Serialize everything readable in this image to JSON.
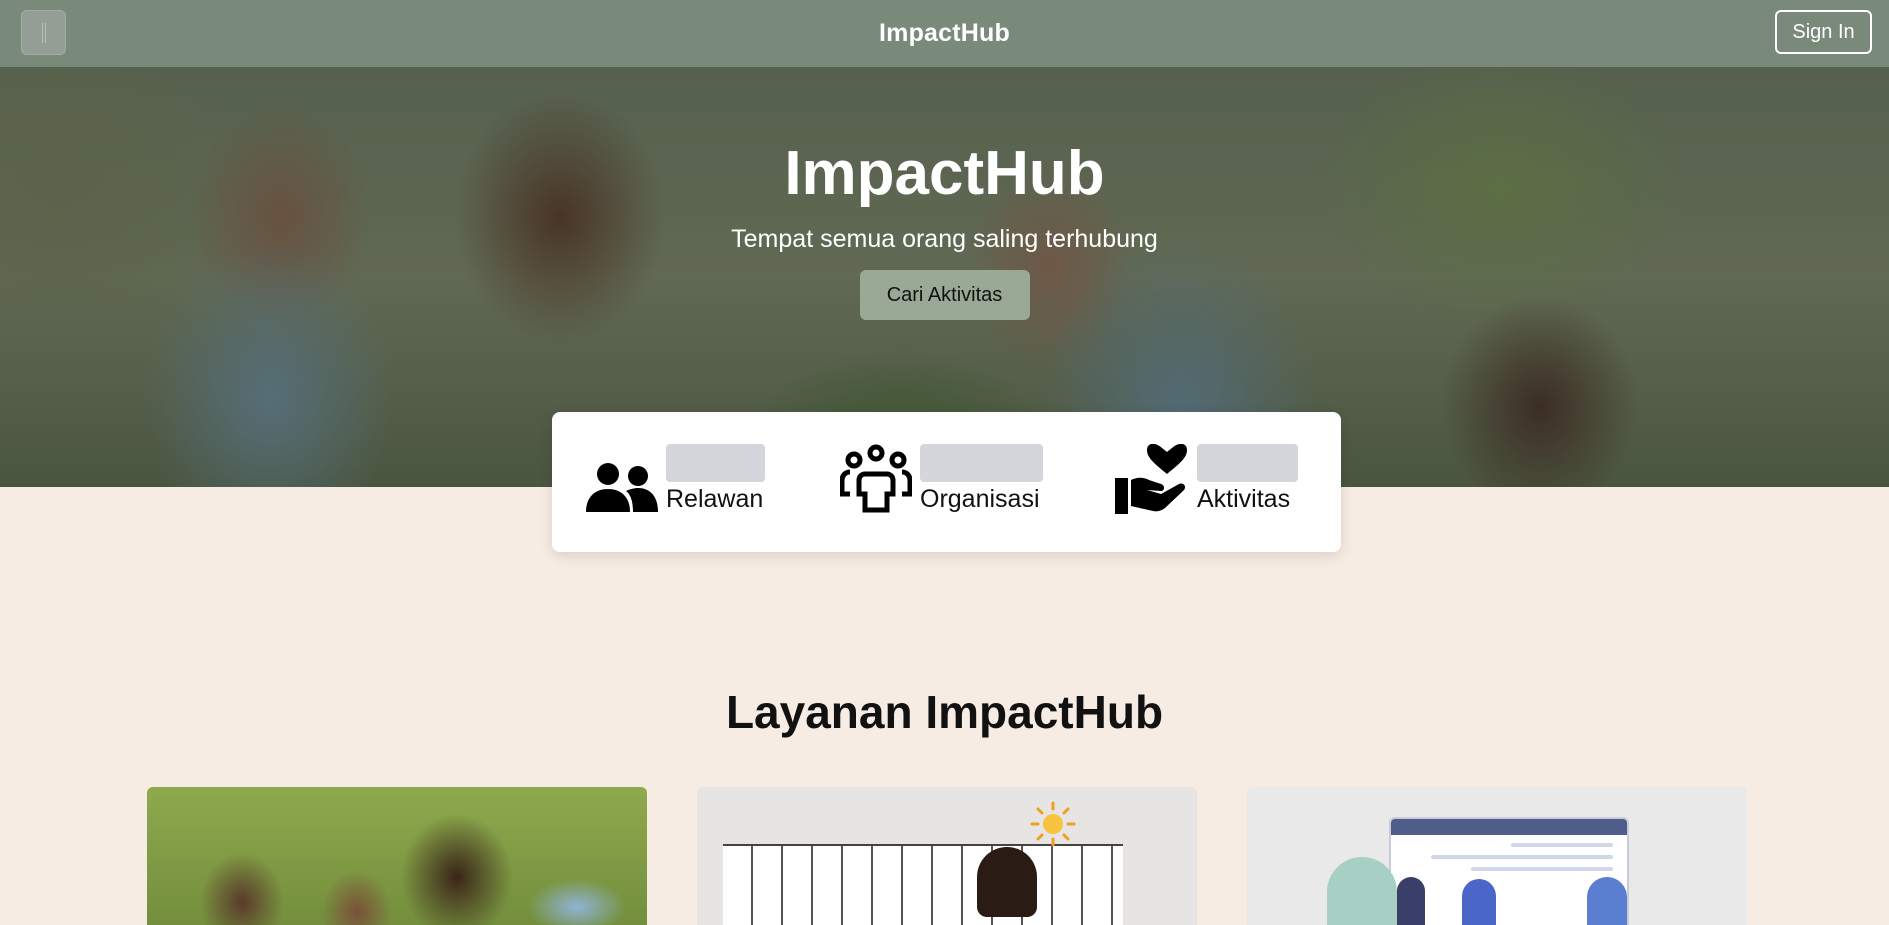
{
  "header": {
    "menu_icon": "menu-icon",
    "brand": "ImpactHub",
    "signin_label": "Sign In"
  },
  "hero": {
    "title": "ImpactHub",
    "subtitle": "Tempat semua orang saling terhubung",
    "cta_label": "Cari Aktivitas"
  },
  "stats": [
    {
      "icon": "people-icon",
      "label": "Relawan"
    },
    {
      "icon": "group-icon",
      "label": "Organisasi"
    },
    {
      "icon": "hand-heart-icon",
      "label": "Aktivitas"
    }
  ],
  "services": {
    "title": "Layanan ImpactHub"
  },
  "colors": {
    "header_bg": "#79897a",
    "page_bg": "#f7ece3",
    "cta_bg": "#9aa996",
    "placeholder": "#d4d6dc"
  }
}
